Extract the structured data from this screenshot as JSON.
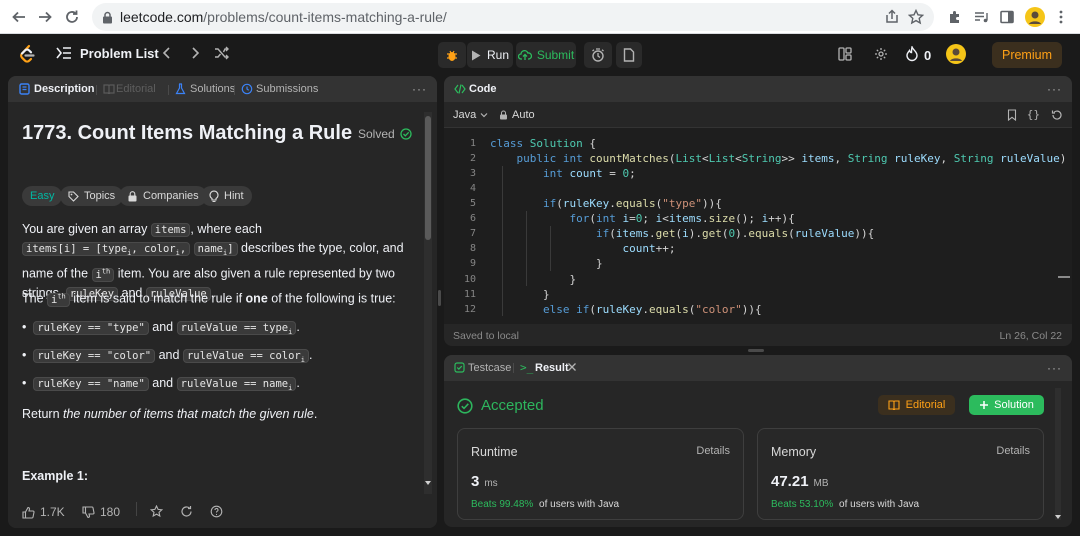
{
  "browser": {
    "url_host": "leetcode.com",
    "url_path": "/problems/count-items-matching-a-rule/"
  },
  "nav": {
    "problem_list": "Problem List",
    "run": "Run",
    "submit": "Submit",
    "streak_count": "0",
    "premium": "Premium"
  },
  "description_panel": {
    "tabs": [
      "Description",
      "Editorial",
      "Solutions",
      "Submissions"
    ],
    "title": "1773. Count Items Matching a Rule",
    "solved": "Solved",
    "tags": [
      "Easy",
      "Topics",
      "Companies",
      "Hint"
    ],
    "p1": {
      "t1": "You are given an array ",
      "c1": "items",
      "t2": ", where each ",
      "c2": "items[i] = [type",
      "c2sub": "i",
      "c2b": ", color",
      "c2bsub": "i",
      "c2c": ",",
      "c3": "name",
      "c3sub": "i",
      "c3b": "]",
      "t3": " describes the type, color, and name of the ",
      "c4": "i",
      "c4sup": "th",
      "t4": " item. You are also given a rule represented by two strings, ",
      "c5": "ruleKey",
      "t5": " and ",
      "c6": "ruleValue",
      "t6": "."
    },
    "p2": {
      "t1": "The ",
      "c1": "i",
      "c1sup": "th",
      "t2": " item is said to match the rule if ",
      "b1": "one",
      "t3": " of the following is true:"
    },
    "bullets": [
      {
        "a": "ruleKey == \"type\"",
        "and": "and",
        "b": "ruleValue == type",
        "sub": "i",
        "end": "."
      },
      {
        "a": "ruleKey == \"color\"",
        "and": "and",
        "b": "ruleValue == color",
        "sub": "i",
        "end": "."
      },
      {
        "a": "ruleKey == \"name\"",
        "and": "and",
        "b": "ruleValue == name",
        "sub": "i",
        "end": "."
      }
    ],
    "p3": {
      "t1": "Return ",
      "i1": "the number of items that match the given rule",
      "t2": "."
    },
    "example_heading": "Example 1:",
    "footer": {
      "likes": "1.7K",
      "dislikes": "180"
    }
  },
  "code_panel": {
    "tab": "Code",
    "language": "Java",
    "mode": "Auto",
    "status": "Saved to local",
    "cursor": "Ln 26, Col 22",
    "line_numbers": [
      "1",
      "2",
      "3",
      "4",
      "5",
      "6",
      "7",
      "8",
      "9",
      "10",
      "11",
      "12"
    ]
  },
  "result_panel": {
    "tabs": [
      "Testcase",
      "Result"
    ],
    "status": "Accepted",
    "editorial": "Editorial",
    "solution": "Solution",
    "runtime": {
      "label": "Runtime",
      "details": "Details",
      "value": "3",
      "unit": "ms",
      "beats": "Beats 99.48%",
      "beats_text": "of users with Java"
    },
    "memory": {
      "label": "Memory",
      "details": "Details",
      "value": "47.21",
      "unit": "MB",
      "beats": "Beats 53.10%",
      "beats_text": "of users with Java"
    }
  },
  "colors": {
    "accent_green": "#2cbb5d",
    "accepted_green": "#2db55d",
    "premium_orange": "#ffa116",
    "easy_teal": "#00b8a3"
  }
}
